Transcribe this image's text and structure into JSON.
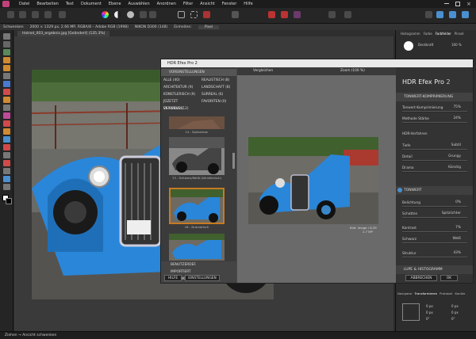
{
  "menu": [
    "Datei",
    "Bearbeiten",
    "Text",
    "Dokument",
    "Ebene",
    "Auswählen",
    "Anordnen",
    "Filter",
    "Ansicht",
    "Fenster",
    "Hilfe"
  ],
  "context": {
    "tool": "Schwenken",
    "doc_info": "2000 × 1329 px, 2.66 MP, RGBA/8 – Adobe RGB (1998)",
    "camera": "NIKON D300 (148)",
    "units_label": "Einheiten:",
    "units_value": "Pixel"
  },
  "document_tab": "Hotrod_003_ergebnis.jpg [Geändert] (135.3%)",
  "right_panel": {
    "tabs": [
      "Histogramm",
      "Farbe",
      "Farbfelder",
      "Pinsel"
    ],
    "opacity_label": "Deckkraft",
    "opacity_value": "100 %",
    "bottom_tabs": [
      "Navigator",
      "Transformieren",
      "Protokoll",
      "Kanäle"
    ],
    "transform_values": [
      "0 px",
      "0 px",
      "0 px",
      "0 px",
      "0°",
      "0°"
    ]
  },
  "status": "Ziehen → Ansicht schwenken",
  "dialog": {
    "title": "HDR Efex Pro 2",
    "presets_header": "VOREINSTELLUNGEN",
    "categories": [
      [
        "ALLE (40)",
        "REALISTISCH (8)"
      ],
      [
        "ARCHITEKTUR (9)",
        "LANDSCHAFT (8)"
      ],
      [
        "KÜNSTLERISCH (9)",
        "SURREAL (6)"
      ],
      [
        "JÜZETZT VERWENDE",
        "FAVORITEN (0)"
      ],
      [
        "EK FOKUS (12)",
        ""
      ]
    ],
    "preset_captions": [
      "14 - Spitzenton",
      "13 - Schwarz/Weiß (künstlerisch)",
      "16 - Dramatisch",
      ""
    ],
    "left_sections": [
      "BENUTZERDEF.",
      "IMPORTIERT",
      "PROTOKOLL"
    ],
    "help_label": "HILFE",
    "settings_label": "EINSTELLUNGEN",
    "view_label": "Vergleichen",
    "zoom_label": "Zoom (100 %)",
    "image_info": "Bild: Image / 8.39",
    "image_size": "2.7 MP",
    "brand_a": "HDR Efex Pro",
    "brand_b": "2",
    "right_sections": {
      "tone": "TONWERT-KOMPRIMIERUNG",
      "hdr": "HDR-Verfahren",
      "tonwert": "TONWERT",
      "lupe": "LUPE & HISTOGRAMM"
    },
    "tone_sliders": [
      {
        "label": "Tonwert-Komprimierung",
        "value": "75%"
      },
      {
        "label": "Methode Stärke",
        "value": "24%"
      }
    ],
    "hdr_rows": [
      {
        "left": "Tiefe",
        "right": "Subtil"
      },
      {
        "left": "Detail",
        "right": "Grungy"
      },
      {
        "left": "Drama",
        "right": "Künstig"
      }
    ],
    "tonwert_sliders": [
      {
        "label": "Belichtung",
        "value": "0%"
      },
      {
        "label": "Schatten",
        "value": "Spitzlichter"
      },
      {
        "label": "Kontrast",
        "value": "7%"
      },
      {
        "label": "Schwarz",
        "value": "Weiß"
      },
      {
        "label": "Struktur",
        "value": "43%"
      }
    ],
    "cancel_label": "ABBRECHEN",
    "ok_label": "OK"
  },
  "colors": {
    "accent_car": "#2a86d8",
    "dialog_bg": "#4a4a4a",
    "selection": "#c87a22"
  }
}
